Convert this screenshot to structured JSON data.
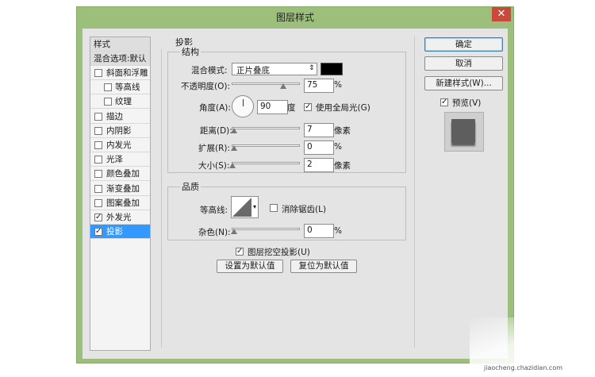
{
  "window": {
    "title": "图层样式",
    "close_glyph": "✕"
  },
  "style_list": {
    "header": "样式",
    "blend_options": "混合选项:默认",
    "items": [
      {
        "label": "斜面和浮雕",
        "checked": false,
        "indent": false
      },
      {
        "label": "等高线",
        "checked": false,
        "indent": true
      },
      {
        "label": "纹理",
        "checked": false,
        "indent": true
      },
      {
        "label": "描边",
        "checked": false,
        "indent": false
      },
      {
        "label": "内阴影",
        "checked": false,
        "indent": false
      },
      {
        "label": "内发光",
        "checked": false,
        "indent": false
      },
      {
        "label": "光泽",
        "checked": false,
        "indent": false
      },
      {
        "label": "颜色叠加",
        "checked": false,
        "indent": false
      },
      {
        "label": "渐变叠加",
        "checked": false,
        "indent": false
      },
      {
        "label": "图案叠加",
        "checked": false,
        "indent": false
      },
      {
        "label": "外发光",
        "checked": true,
        "indent": false
      },
      {
        "label": "投影",
        "checked": true,
        "indent": false,
        "selected": true
      }
    ]
  },
  "panel": {
    "title": "投影",
    "structure": {
      "legend": "结构",
      "blend_mode_label": "混合模式:",
      "blend_mode_value": "正片叠底",
      "blend_color": "#000000",
      "opacity_label": "不透明度(O):",
      "opacity_value": "75",
      "opacity_unit": "%",
      "angle_label": "角度(A):",
      "angle_value": "90",
      "angle_unit": "度",
      "global_light_label": "使用全局光(G)",
      "global_light_checked": true,
      "distance_label": "距离(D):",
      "distance_value": "7",
      "distance_unit": "像素",
      "spread_label": "扩展(R):",
      "spread_value": "0",
      "spread_unit": "%",
      "size_label": "大小(S):",
      "size_value": "2",
      "size_unit": "像素"
    },
    "quality": {
      "legend": "品质",
      "contour_label": "等高线:",
      "antialias_label": "消除锯齿(L)",
      "antialias_checked": false,
      "noise_label": "杂色(N):",
      "noise_value": "0",
      "noise_unit": "%"
    },
    "knockout_label": "图层挖空投影(U)",
    "knockout_checked": true,
    "make_default_label": "设置为默认值",
    "reset_default_label": "复位为默认值"
  },
  "sliders": {
    "opacity": 0.75,
    "distance": 0.03,
    "spread": 0.0,
    "size": 0.01,
    "noise": 0.0
  },
  "actions": {
    "ok": "确定",
    "cancel": "取消",
    "new_style": "新建样式(W)...",
    "preview_label": "预览(V)",
    "preview_checked": true
  },
  "watermark": "jiaocheng.chazidian.com"
}
